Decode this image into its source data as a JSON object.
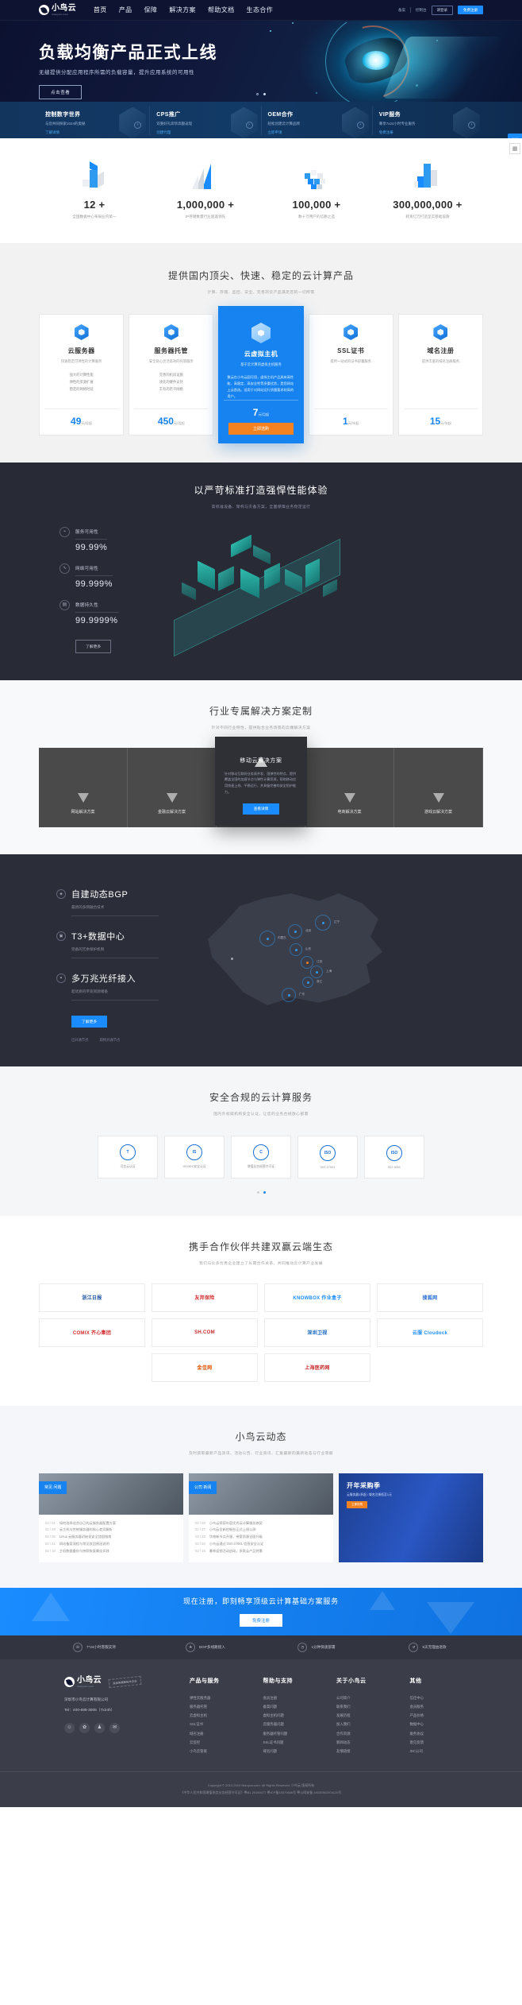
{
  "header": {
    "logo_cn": "小鸟云",
    "logo_en": "niaoyun.com",
    "nav": [
      {
        "label": "首页"
      },
      {
        "label": "产品"
      },
      {
        "label": "保障"
      },
      {
        "label": "解决方案"
      },
      {
        "label": "帮助文档"
      },
      {
        "label": "生态合作"
      }
    ],
    "right": {
      "filing": "备案",
      "console": "控制台",
      "login": "请登录",
      "register": "免费注册"
    }
  },
  "hero": {
    "title": "负载均衡产品正式上线",
    "subtitle": "无缝提供分配应用程序所需的负载容量，提升应用系统的可用性",
    "button": "点击查看",
    "slide_index": 2,
    "slide_count": 2
  },
  "promo": {
    "cards": [
      {
        "title": "控制数字世界",
        "desc": "与您共同探索1024的奥秘",
        "link": "了解详情"
      },
      {
        "title": "CPS推广",
        "desc": "双重好礼即享高额返现",
        "link": "创建代理"
      },
      {
        "title": "OEM合作",
        "desc": "轻松创建云计算品牌",
        "link": "立即申请"
      },
      {
        "title": "VIP服务",
        "desc": "尊享7x24小时专业服务",
        "link": "免费注册"
      }
    ],
    "fab_icon": "headset-icon"
  },
  "stats": {
    "items": [
      {
        "number": "12 +",
        "label": "全国数据中心布局业内第一",
        "icon": "iso-tower-icon"
      },
      {
        "number": "1,000,000 +",
        "label": "IP存储数量行业遥遥领先",
        "icon": "iso-wing-icon"
      },
      {
        "number": "100,000 +",
        "label": "数十万用户的信赖之选",
        "icon": "iso-cubes-icon"
      },
      {
        "number": "300,000,000 +",
        "label": "耗资亿万打造坚实基础设施",
        "icon": "iso-city-icon"
      }
    ],
    "qr_icon": "qr-code-icon"
  },
  "products": {
    "title": "提供国内顶尖、快速、稳定的云计算产品",
    "subtitle": "计算、存储、监控、安全，完善的云产品满足您的一切所需",
    "cards": [
      {
        "name": "云服务器",
        "desc": "快速稳定可弹性的计算服务",
        "features": [
          "强大的计算性能",
          "弹性的资源扩展",
          "稳定的网络时延"
        ],
        "price": "49",
        "unit": "元/月起",
        "highlight": false
      },
      {
        "name": "服务器托管",
        "desc": "安全贴心灵活高效的托管服务",
        "features": [
          "完善的机房设施",
          "领先的硬件支持",
          "丰有的若干网络"
        ],
        "price": "450",
        "unit": "元/月起",
        "highlight": false
      },
      {
        "name": "云虚拟主机",
        "desc": "基于云计算的虚拟主机服务",
        "body": "聚云在小鸟云园可用，虚拟主机产品具有高性能、高稳定、高安全性等多重优势，是您网站上云首选。适用于对网站运行质量要求较高的用户。",
        "price": "7",
        "unit": "元/月起",
        "highlight": true,
        "buy": "立即选购"
      },
      {
        "name": "SSL证书",
        "desc": "提供一站式的证书部署服务",
        "price": "1",
        "unit": "元/年起",
        "highlight": false
      },
      {
        "name": "域名注册",
        "desc": "提供丰富的域名注册服务",
        "price": "15",
        "unit": "元/年起",
        "highlight": false
      }
    ]
  },
  "reliability": {
    "title": "以严苛标准打造强悍性能体验",
    "subtitle": "高标准设备、架构与灾备方案，全面保障业务稳定运行",
    "metrics": [
      {
        "label": "服务可用性",
        "value": "99.99%",
        "icon": "signal-icon"
      },
      {
        "label": "网络可用性",
        "value": "99.999%",
        "icon": "pulse-icon"
      },
      {
        "label": "数据持久性",
        "value": "99.9999%",
        "icon": "database-icon"
      }
    ],
    "button": "了解更多"
  },
  "solutions": {
    "title": "行业专属解决方案定制",
    "subtitle": "针对不同行业特性，提供贴合业务场景的云端解决方案",
    "items": [
      {
        "label": "网站解决方案",
        "icon": "web-icon"
      },
      {
        "label": "金融云解决方案",
        "icon": "finance-icon"
      },
      {
        "label": "移动云解决方案",
        "icon": "mobile-icon"
      },
      {
        "label": "电商解决方案",
        "icon": "ecommerce-icon"
      },
      {
        "label": "游戏云解决方案",
        "icon": "game-icon"
      }
    ],
    "popup": {
      "title": "移动云解决方案",
      "desc": "针对移动互联网业务高并发、强弹性的特点，提供覆盖全国的加速节点与弹性计算资源，帮助移动应用快速上线、平稳运行，并具备完善的安全防护能力。",
      "button": "查看详情"
    }
  },
  "network": {
    "items": [
      {
        "title": "自建动态BGP",
        "desc": "最新的多网融合技术",
        "icon": "bgp-icon"
      },
      {
        "title": "T3+数据中心",
        "desc": "完备的冗余保护机制",
        "icon": "datacenter-icon"
      },
      {
        "title": "多万兆光纤接入",
        "desc": "超优质的带宽资源储备",
        "icon": "fiber-icon"
      }
    ],
    "button": "了解更多",
    "tags": [
      "已开通节点",
      "即将开通节点"
    ],
    "map_nodes": [
      {
        "name": "辽宁"
      },
      {
        "name": "北京"
      },
      {
        "name": "内蒙古"
      },
      {
        "name": "山东"
      },
      {
        "name": "江苏"
      },
      {
        "name": "上海"
      },
      {
        "name": "浙江"
      },
      {
        "name": "广东"
      }
    ]
  },
  "security": {
    "title": "安全合规的云计算服务",
    "subtitle": "国内外权威机构安全认证，让您的业务合规放心部署",
    "certs": [
      {
        "name": "TRUCS",
        "label": "可信云认证",
        "badge": "T"
      },
      {
        "name": "ISO/IEC",
        "label": "ISO/IEC安全认证",
        "badge": "IS"
      },
      {
        "name": "C",
        "label": "增值业务经营许可证",
        "badge": "C"
      },
      {
        "name": "ISO",
        "label": "ISO 27001",
        "badge": "ISO"
      },
      {
        "name": "ISO",
        "label": "ISO 9001",
        "badge": "ISO"
      }
    ],
    "dot_index": 1
  },
  "partners": {
    "title": "携手合作伙伴共建双赢云端生态",
    "subtitle": "我们与众多优秀企业建立了长期合作关系，共同推动云计算产业发展",
    "logos": [
      {
        "name": "浙江日报",
        "color": "#1a4fa0"
      },
      {
        "name": "友邦保险",
        "color": "#d32f2f"
      },
      {
        "name": "KNOWBOX 作业盒子",
        "color": "#1a8cff"
      },
      {
        "name": "搜狐网",
        "color": "#2b6fd6"
      },
      {
        "name": "COMIX 齐心集团",
        "color": "#d32f2f"
      },
      {
        "name": "SH.COM",
        "color": "#c62828"
      },
      {
        "name": "深圳卫视",
        "color": "#1565c0"
      },
      {
        "name": "云服 Cloudock",
        "color": "#1a8cff"
      },
      {
        "name": "金佳网",
        "color": "#e65100"
      },
      {
        "name": "上海医药网",
        "color": "#c62828"
      }
    ]
  },
  "news": {
    "title": "小鸟云动态",
    "subtitle": "及时获取最新产品资讯、活动公告、行业资讯、汇集最新的最新动态与行业洞察",
    "cards": [
      {
        "tag": "常见\n问题",
        "items": [
          {
            "date": "03 / 01",
            "text": "如何选择适合自己的云服务器配置方案"
          },
          {
            "date": "02 / 28",
            "text": "云主机与传统服务器的核心差异解析"
          },
          {
            "date": "02 / 25",
            "text": "Linux 云服务器初始化安全加固指南"
          },
          {
            "date": "02 / 21",
            "text": "网站备案流程与常见驳回原因说明"
          },
          {
            "date": "02 / 18",
            "text": "主机数据备份与快照恢复最佳实践"
          }
        ]
      },
      {
        "tag": "公司\n新闻",
        "items": [
          {
            "date": "03 / 02",
            "text": "小鸟云荣获年度优秀云计算服务商奖"
          },
          {
            "date": "02 / 27",
            "text": "小鸟云全新控制台正式上线公测"
          },
          {
            "date": "02 / 23",
            "text": "华南新节点开服，带宽资源全面升级"
          },
          {
            "date": "02 / 20",
            "text": "小鸟云通过 ISO 27001 信息安全认证"
          },
          {
            "date": "02 / 16",
            "text": "春季促销活动启动，多款云产品特惠"
          }
        ]
      },
      {
        "promo_title": "开年采购季",
        "promo_sub": "云服务器1折起 / 域名注册低至1元",
        "promo_button": "立即抢购"
      }
    ]
  },
  "cta": {
    "text": "现在注册，即刻畅享顶级云计算基础方案服务",
    "button": "免费注册"
  },
  "service_bar": {
    "items": [
      {
        "label": "7*24小时客服支持",
        "icon": "headset-icon"
      },
      {
        "label": "BGP多线路接入",
        "icon": "network-icon"
      },
      {
        "label": "1分钟快速部署",
        "icon": "clock-icon"
      },
      {
        "label": "5天无理由退款",
        "icon": "refund-icon"
      }
    ]
  },
  "footer": {
    "logo_cn": "小鸟云",
    "logo_en": "niaoyun.com",
    "ribbon": "深圳市高新技术企业",
    "company": "深圳市小鸟云计算有限公司",
    "tel": "Tel：400-688-3005（7x24h）",
    "socials": [
      "wechat-icon",
      "weibo-icon",
      "qq-icon",
      "mail-icon"
    ],
    "columns": [
      {
        "title": "产品与服务",
        "links": [
          "弹性云服务器",
          "服务器托管",
          "云虚拟主机",
          "SSL证书",
          "域名注册",
          "云监控",
          "小鸟云管家"
        ]
      },
      {
        "title": "帮助与支持",
        "links": [
          "会员注册",
          "备案问题",
          "虚拟主机问题",
          "云服务器问题",
          "服务器托管问题",
          "SSL证书问题",
          "域名问题"
        ]
      },
      {
        "title": "关于小鸟云",
        "links": [
          "公司简介",
          "联系我们",
          "发展历程",
          "加入我们",
          "合作资源",
          "新闻动态",
          "友情链接"
        ]
      },
      {
        "title": "其他",
        "links": [
          "信任中心",
          "会员服务",
          "产品价格",
          "数据中心",
          "服务协议",
          "意见反馈",
          "IDC公司"
        ]
      }
    ],
    "copyright": "Copyright © 2013-2019 Niaoyun.com. All Rights Reserved. 小鸟云 版权所有",
    "license": "《中华人民共和国增值电信业务经营许可证》粤B1-20160477    粤ICP备15070606号    粤公网安备 44030502004120号"
  }
}
